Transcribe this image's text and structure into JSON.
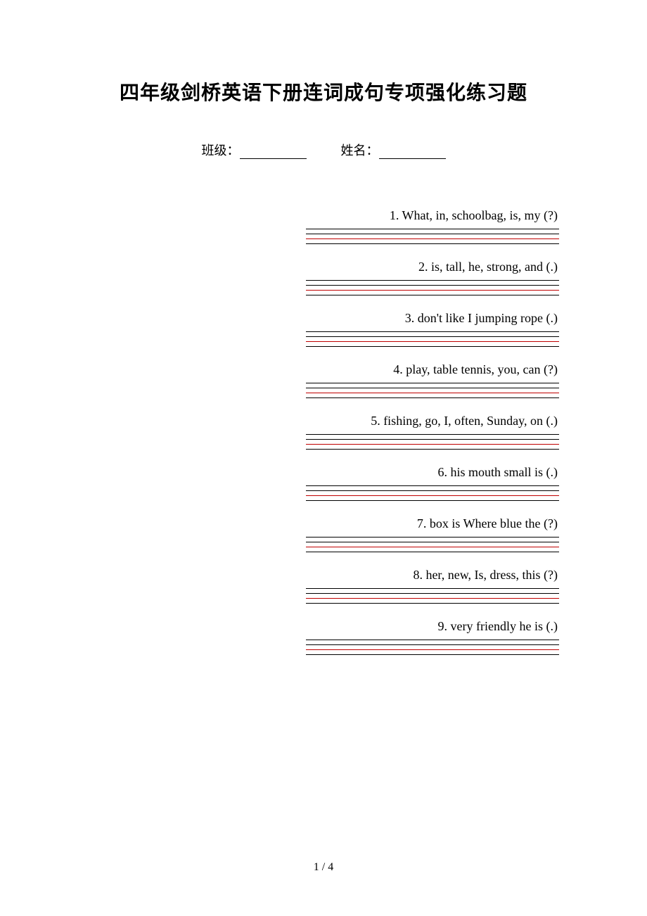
{
  "title": "四年级剑桥英语下册连词成句专项强化练习题",
  "info": {
    "class_label": "班级：",
    "name_label": "姓名："
  },
  "questions": [
    {
      "text": "1. What, in, schoolbag, is, my (?)"
    },
    {
      "text": "2. is, tall, he, strong, and (.)"
    },
    {
      "text": "3. don't  like  I  jumping  rope (.)"
    },
    {
      "text": "4. play, table tennis, you, can (?)"
    },
    {
      "text": "5. fishing, go, I, often, Sunday, on (.)"
    },
    {
      "text": "6. his mouth small is (.)"
    },
    {
      "text": "7. box    is    Where    blue    the (?)"
    },
    {
      "text": "8. her, new, Is, dress, this (?)"
    },
    {
      "text": "9. very    friendly    he    is (.)"
    }
  ],
  "page_number": "1 / 4"
}
